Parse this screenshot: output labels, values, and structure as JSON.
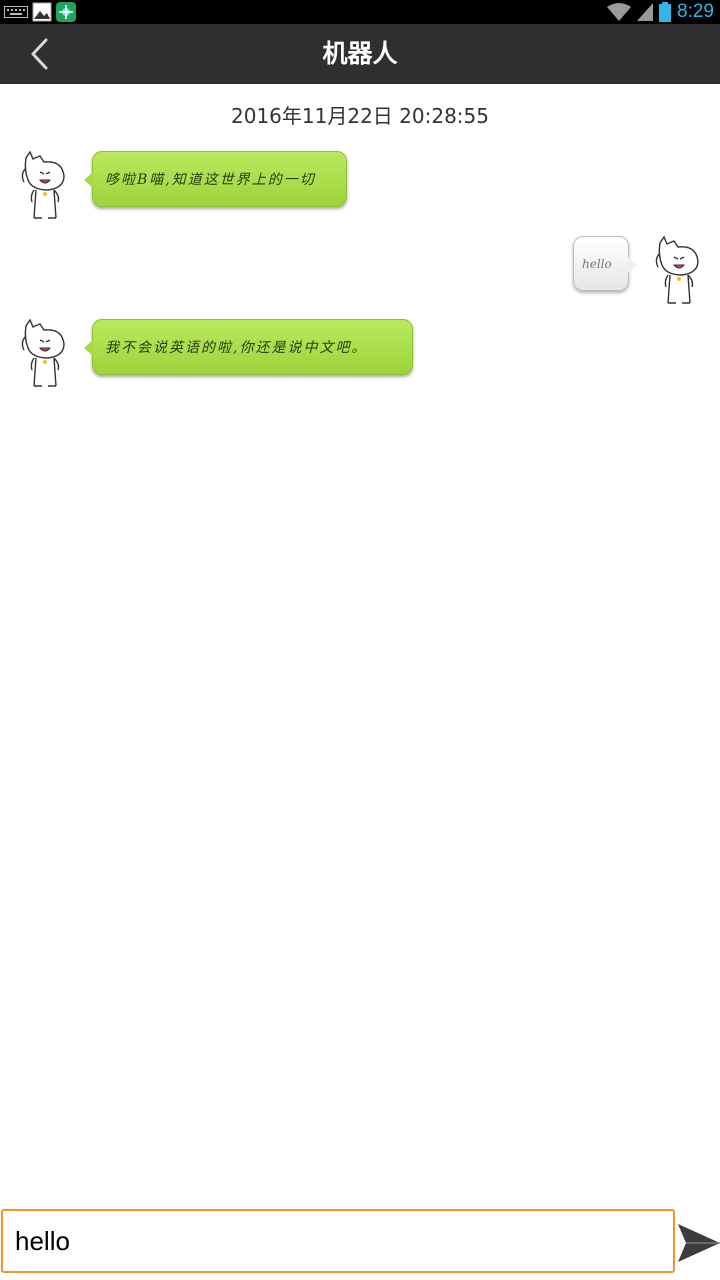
{
  "status_bar": {
    "time": "8:29"
  },
  "header": {
    "title": "机器人"
  },
  "chat": {
    "timestamp": "2016年11月22日 20:28:55",
    "messages": [
      {
        "sender": "robot",
        "text": "哆啦B喵,知道这世界上的一切"
      },
      {
        "sender": "user",
        "text": "hello"
      },
      {
        "sender": "robot",
        "text": "我不会说英语的啦,你还是说中文吧。"
      }
    ]
  },
  "input": {
    "value": "hello"
  },
  "icons": {
    "back": "chevron-left-icon",
    "send": "send-arrow-icon",
    "wifi": "wifi-icon",
    "signal": "signal-icon",
    "battery": "battery-icon"
  },
  "colors": {
    "header_bg": "#2f2f2f",
    "robot_bubble": "#a8dc47",
    "user_bubble": "#f0f0f0",
    "input_border": "#f0962a",
    "status_time": "#33b5e5"
  }
}
